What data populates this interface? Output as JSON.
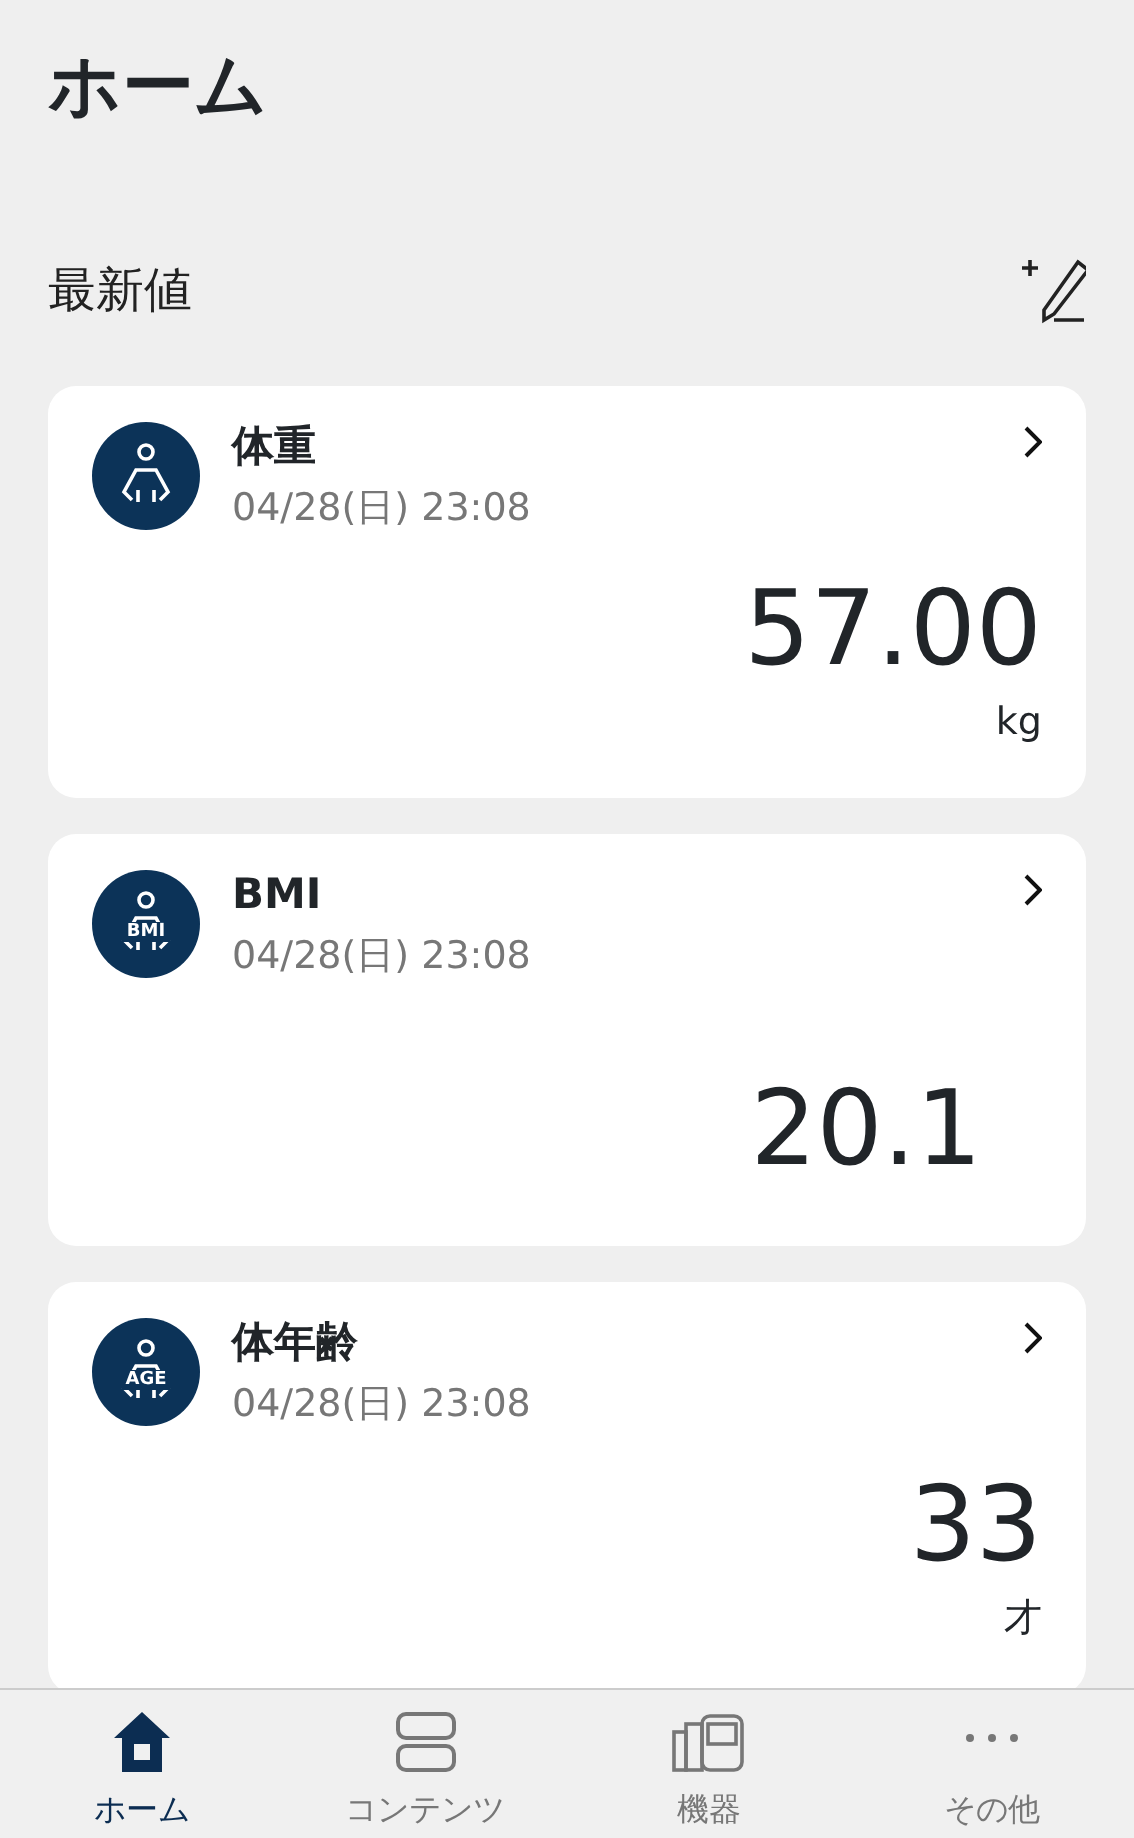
{
  "title": "ホーム",
  "section": {
    "label": "最新値"
  },
  "cards": [
    {
      "name": "体重",
      "date": "04/28(日) 23:08",
      "value": "57.00",
      "unit": "kg"
    },
    {
      "name": "BMI",
      "icon_text": "BMI",
      "date": "04/28(日) 23:08",
      "value": "20.1"
    },
    {
      "name": "体年齢",
      "icon_text": "AGE",
      "date": "04/28(日) 23:08",
      "value": "33",
      "unit": "才"
    }
  ],
  "nav": [
    {
      "kind": "home",
      "label": "ホーム",
      "selected": true
    },
    {
      "kind": "contents",
      "label": "コンテンツ",
      "selected": false
    },
    {
      "kind": "devices",
      "label": "機器",
      "selected": false
    },
    {
      "kind": "more",
      "label": "その他",
      "selected": false
    }
  ]
}
